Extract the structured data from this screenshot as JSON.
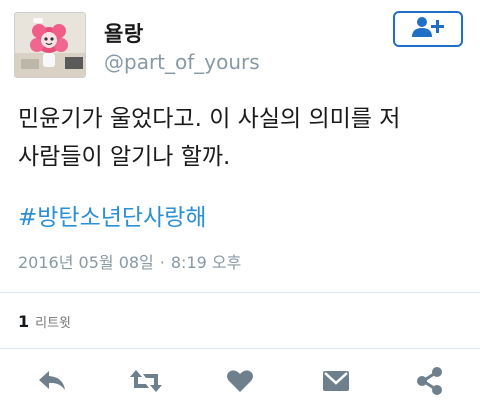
{
  "user": {
    "display_name": "욜랑",
    "handle": "@part_of_yours"
  },
  "header": {
    "follow_icon": "follow-person-plus-icon"
  },
  "tweet": {
    "text_line1": "민윤기가 울었다고. 이 사실의 의미를 저",
    "text_line2": "사람들이 알기나 할까.",
    "hashtag": "#방탄소년단사랑해",
    "date": "2016년 05월 08일",
    "separator": "·",
    "time": "8:19 오후"
  },
  "stats": {
    "retweet_count": "1",
    "retweet_label": "리트윗"
  },
  "actions": {
    "icons": [
      "reply-icon",
      "retweet-icon",
      "like-heart-icon",
      "message-envelope-icon",
      "share-icon"
    ]
  },
  "colors": {
    "accent": "#1f6fc4",
    "hashtag": "#2a8fd4",
    "muted": "#8899a6",
    "action_icon": "#6e7f8d"
  }
}
